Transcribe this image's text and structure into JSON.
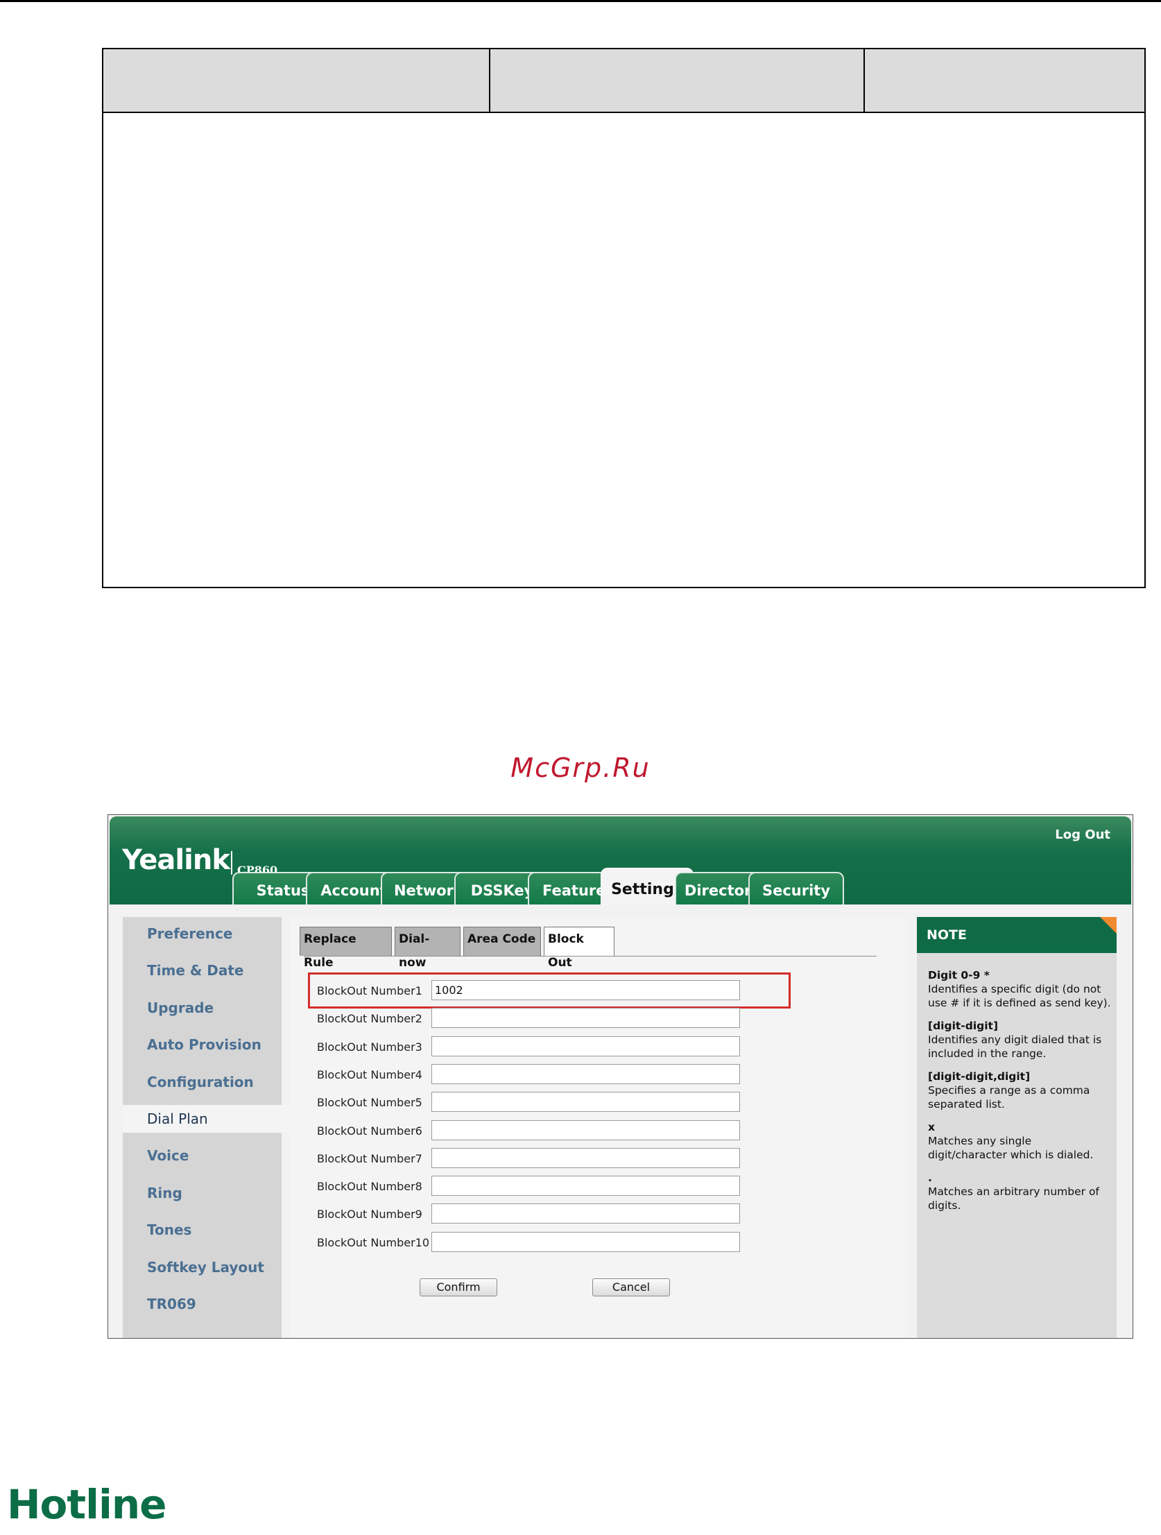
{
  "watermark": "McGrp.Ru",
  "app": {
    "logo": "Yealink",
    "model": "CP860",
    "logout": "Log Out",
    "tabs": [
      "Status",
      "Account",
      "Network",
      "DSSKey",
      "Features",
      "Settings",
      "Directory",
      "Security"
    ],
    "active_tab": "Settings",
    "sidebar": [
      "Preference",
      "Time & Date",
      "Upgrade",
      "Auto Provision",
      "Configuration",
      "Dial Plan",
      "Voice",
      "Ring",
      "Tones",
      "Softkey Layout",
      "TR069"
    ],
    "active_sidebar": "Dial Plan",
    "subtabs": [
      "Replace Rule",
      "Dial-now",
      "Area Code",
      "Block Out"
    ],
    "active_subtab": "Block Out",
    "blockout_rows": [
      {
        "label": "BlockOut Number1",
        "value": "1002"
      },
      {
        "label": "BlockOut Number2",
        "value": ""
      },
      {
        "label": "BlockOut Number3",
        "value": ""
      },
      {
        "label": "BlockOut Number4",
        "value": ""
      },
      {
        "label": "BlockOut Number5",
        "value": ""
      },
      {
        "label": "BlockOut Number6",
        "value": ""
      },
      {
        "label": "BlockOut Number7",
        "value": ""
      },
      {
        "label": "BlockOut Number8",
        "value": ""
      },
      {
        "label": "BlockOut Number9",
        "value": ""
      },
      {
        "label": "BlockOut Number10",
        "value": ""
      }
    ],
    "confirm_label": "Confirm",
    "cancel_label": "Cancel",
    "note": {
      "title": "NOTE",
      "entries": [
        {
          "term": "Digit 0-9 *",
          "desc": "Identifies a specific digit (do not use # if it is defined as send key)."
        },
        {
          "term": "[digit-digit]",
          "desc": "Identifies any digit dialed that is included in the range."
        },
        {
          "term": "[digit-digit,digit]",
          "desc": "Specifies a range as a comma separated list."
        },
        {
          "term": "x",
          "desc": "Matches any single digit/character which is dialed."
        },
        {
          "term": ".",
          "desc": "Matches an arbitrary number of digits."
        }
      ]
    }
  },
  "heading": "Hotline",
  "colors": {
    "brand_green": "#0e6b45",
    "highlight_red": "#d42c2c",
    "watermark_red": "#c0182e",
    "note_corner": "#f08a2e"
  }
}
